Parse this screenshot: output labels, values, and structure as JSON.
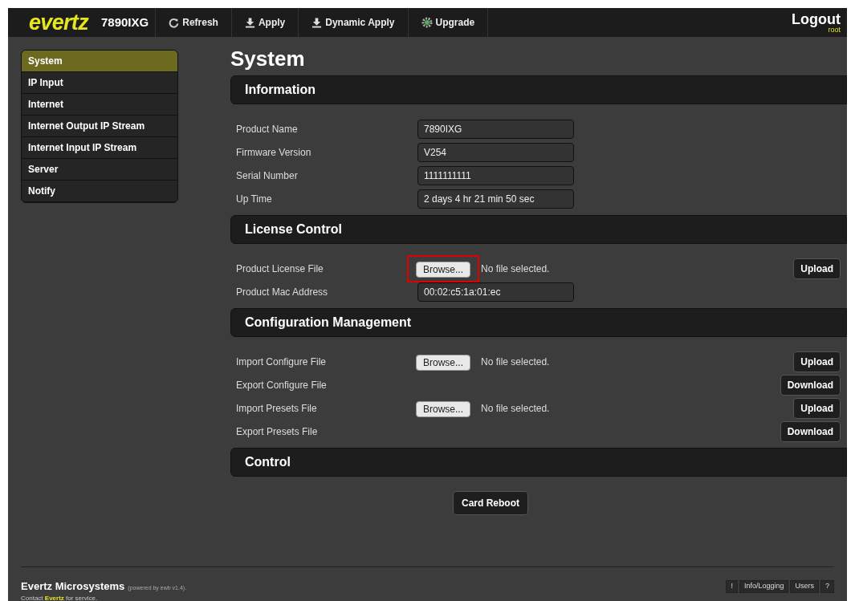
{
  "header": {
    "logo": "evertz",
    "model": "7890IXG",
    "actions": [
      {
        "label": "Refresh",
        "kind": "refresh"
      },
      {
        "label": "Apply",
        "kind": "download"
      },
      {
        "label": "Dynamic Apply",
        "kind": "download"
      },
      {
        "label": "Upgrade",
        "kind": "gear"
      }
    ],
    "logout": "Logout",
    "user": "root"
  },
  "sidebar": {
    "items": [
      {
        "label": "System",
        "selected": true
      },
      {
        "label": "IP Input",
        "selected": false
      },
      {
        "label": "Internet",
        "selected": false
      },
      {
        "label": "Internet Output IP Stream",
        "selected": false
      },
      {
        "label": "Internet Input IP Stream",
        "selected": false
      },
      {
        "label": "Server",
        "selected": false
      },
      {
        "label": "Notify",
        "selected": false
      }
    ]
  },
  "page_title": "System",
  "sections": [
    {
      "title": "Information",
      "rows": [
        {
          "kind": "field",
          "label": "Product Name",
          "value": "7890IXG"
        },
        {
          "kind": "field",
          "label": "Firmware Version",
          "value": "V254"
        },
        {
          "kind": "field",
          "label": "Serial Number",
          "value": "1111111111"
        },
        {
          "kind": "field",
          "label": "Up Time",
          "value": "2 days 4 hr 21 min 50 sec"
        }
      ]
    },
    {
      "title": "License Control",
      "rows": [
        {
          "kind": "file",
          "label": "Product License File",
          "browse": "Browse...",
          "status": "No file selected.",
          "action": "Upload",
          "highlighted": true
        },
        {
          "kind": "field",
          "label": "Product Mac Address",
          "value": "00:02:c5:1a:01:ec"
        }
      ]
    },
    {
      "title": "Configuration Management",
      "rows": [
        {
          "kind": "file",
          "label": "Import Configure File",
          "browse": "Browse...",
          "status": "No file selected.",
          "action": "Upload",
          "highlighted": false
        },
        {
          "kind": "action",
          "label": "Export Configure File",
          "action": "Download"
        },
        {
          "kind": "file",
          "label": "Import Presets File",
          "browse": "Browse...",
          "status": "No file selected.",
          "action": "Upload",
          "highlighted": false
        },
        {
          "kind": "action",
          "label": "Export Presets File",
          "action": "Download"
        }
      ]
    },
    {
      "title": "Control",
      "rows": [
        {
          "kind": "center",
          "action": "Card Reboot"
        }
      ]
    }
  ],
  "footer": {
    "company": "Evertz Microsystems",
    "powered": "(powered by ewb v1.4).",
    "contact": "Contact **Evertz** for service.",
    "buttons": [
      "!",
      "Info/Logging",
      "Users",
      "?"
    ]
  }
}
